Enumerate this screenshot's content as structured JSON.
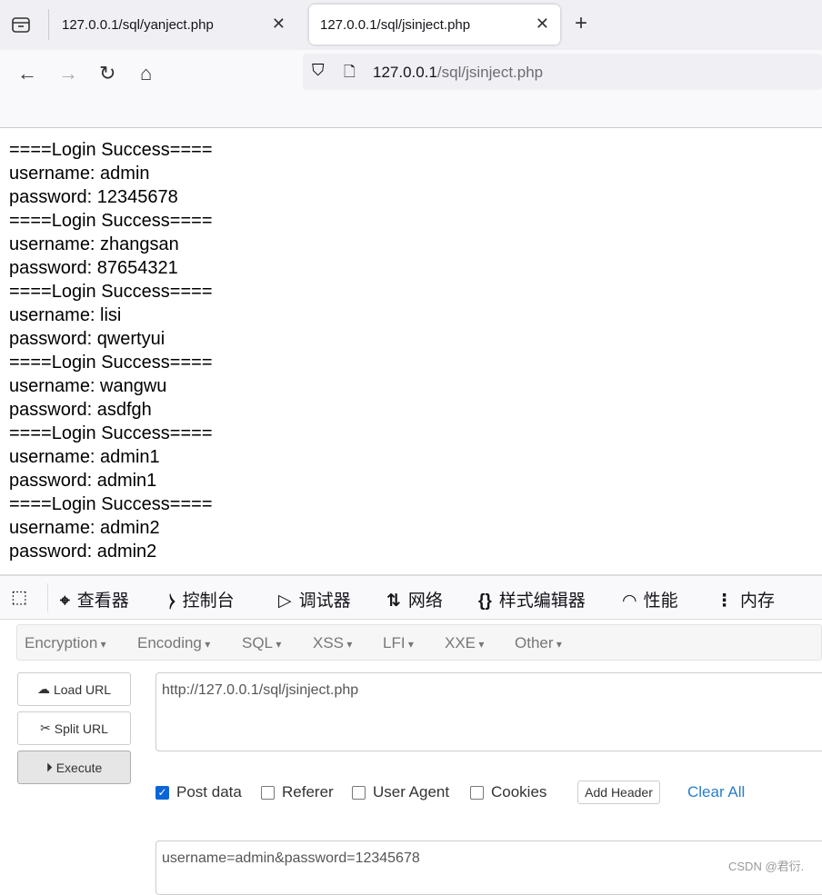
{
  "browser": {
    "tabs": [
      {
        "title": "127.0.0.1/sql/yanject.php",
        "active": false
      },
      {
        "title": "127.0.0.1/sql/jsinject.php",
        "active": true
      }
    ],
    "url_host": "127.0.0.1",
    "url_path": "/sql/jsinject.php"
  },
  "page_lines": [
    "====Login Success====",
    "username: admin",
    "password: 12345678",
    "====Login Success====",
    "username: zhangsan",
    "password: 87654321",
    "====Login Success====",
    "username: lisi",
    "password: qwertyui",
    "====Login Success====",
    "username: wangwu",
    "password: asdfgh",
    "====Login Success====",
    "username: admin1",
    "password: admin1",
    "====Login Success====",
    "username: admin2",
    "password: admin2"
  ],
  "devtools": {
    "tabs": [
      {
        "icon": "inspector-icon",
        "label": "查看器"
      },
      {
        "icon": "console-icon",
        "label": "控制台"
      },
      {
        "icon": "debugger-icon",
        "label": "调试器"
      },
      {
        "icon": "network-icon",
        "label": "网络"
      },
      {
        "icon": "style-editor-icon",
        "label": "样式编辑器"
      },
      {
        "icon": "performance-icon",
        "label": "性能"
      },
      {
        "icon": "memory-icon",
        "label": "内存"
      }
    ]
  },
  "hackbar": {
    "menus": [
      "Encryption",
      "Encoding",
      "SQL",
      "XSS",
      "LFI",
      "XXE",
      "Other"
    ],
    "load_url": "Load URL",
    "split_url": "Split URL",
    "execute": "Execute",
    "url_value": "http://127.0.0.1/sql/jsinject.php",
    "options": [
      {
        "label": "Post data",
        "checked": true
      },
      {
        "label": "Referer",
        "checked": false
      },
      {
        "label": "User Agent",
        "checked": false
      },
      {
        "label": "Cookies",
        "checked": false
      }
    ],
    "add_header": "Add Header",
    "clear_all": "Clear All",
    "post_value": "username=admin&password=12345678"
  },
  "watermark": "CSDN @君衍.",
  "colors": {
    "accent": "#0b65d8",
    "link": "#2a7ec9"
  }
}
